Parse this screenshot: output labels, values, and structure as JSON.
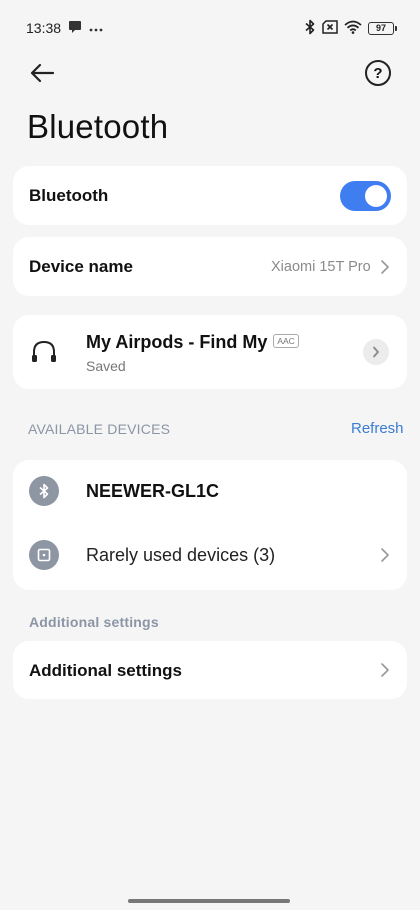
{
  "status_bar": {
    "time": "13:38",
    "notification_icons": [
      "message-icon",
      "more-dots-icon"
    ],
    "right_icons": [
      "bluetooth-icon",
      "no-sim-icon",
      "wifi-icon"
    ],
    "battery_level": "97"
  },
  "header": {
    "title": "Bluetooth"
  },
  "bluetooth_toggle": {
    "label": "Bluetooth",
    "enabled": true
  },
  "device_name": {
    "label": "Device name",
    "value": "Xiaomi 15T Pro"
  },
  "paired_device": {
    "name": "My Airpods - Find My",
    "codec": "AAC",
    "status": "Saved"
  },
  "available_devices": {
    "header": "AVAILABLE DEVICES",
    "refresh_label": "Refresh",
    "items": [
      {
        "name": "NEEWER-GL1C",
        "icon": "bluetooth-icon"
      },
      {
        "name": "Rarely used devices (3)",
        "icon": "device-box-icon"
      }
    ]
  },
  "additional": {
    "header": "Additional settings",
    "row_label": "Additional settings"
  },
  "colors": {
    "accent": "#3f7ef0",
    "link": "#3a7bd5",
    "background": "#f5f5f5",
    "card": "#ffffff"
  }
}
